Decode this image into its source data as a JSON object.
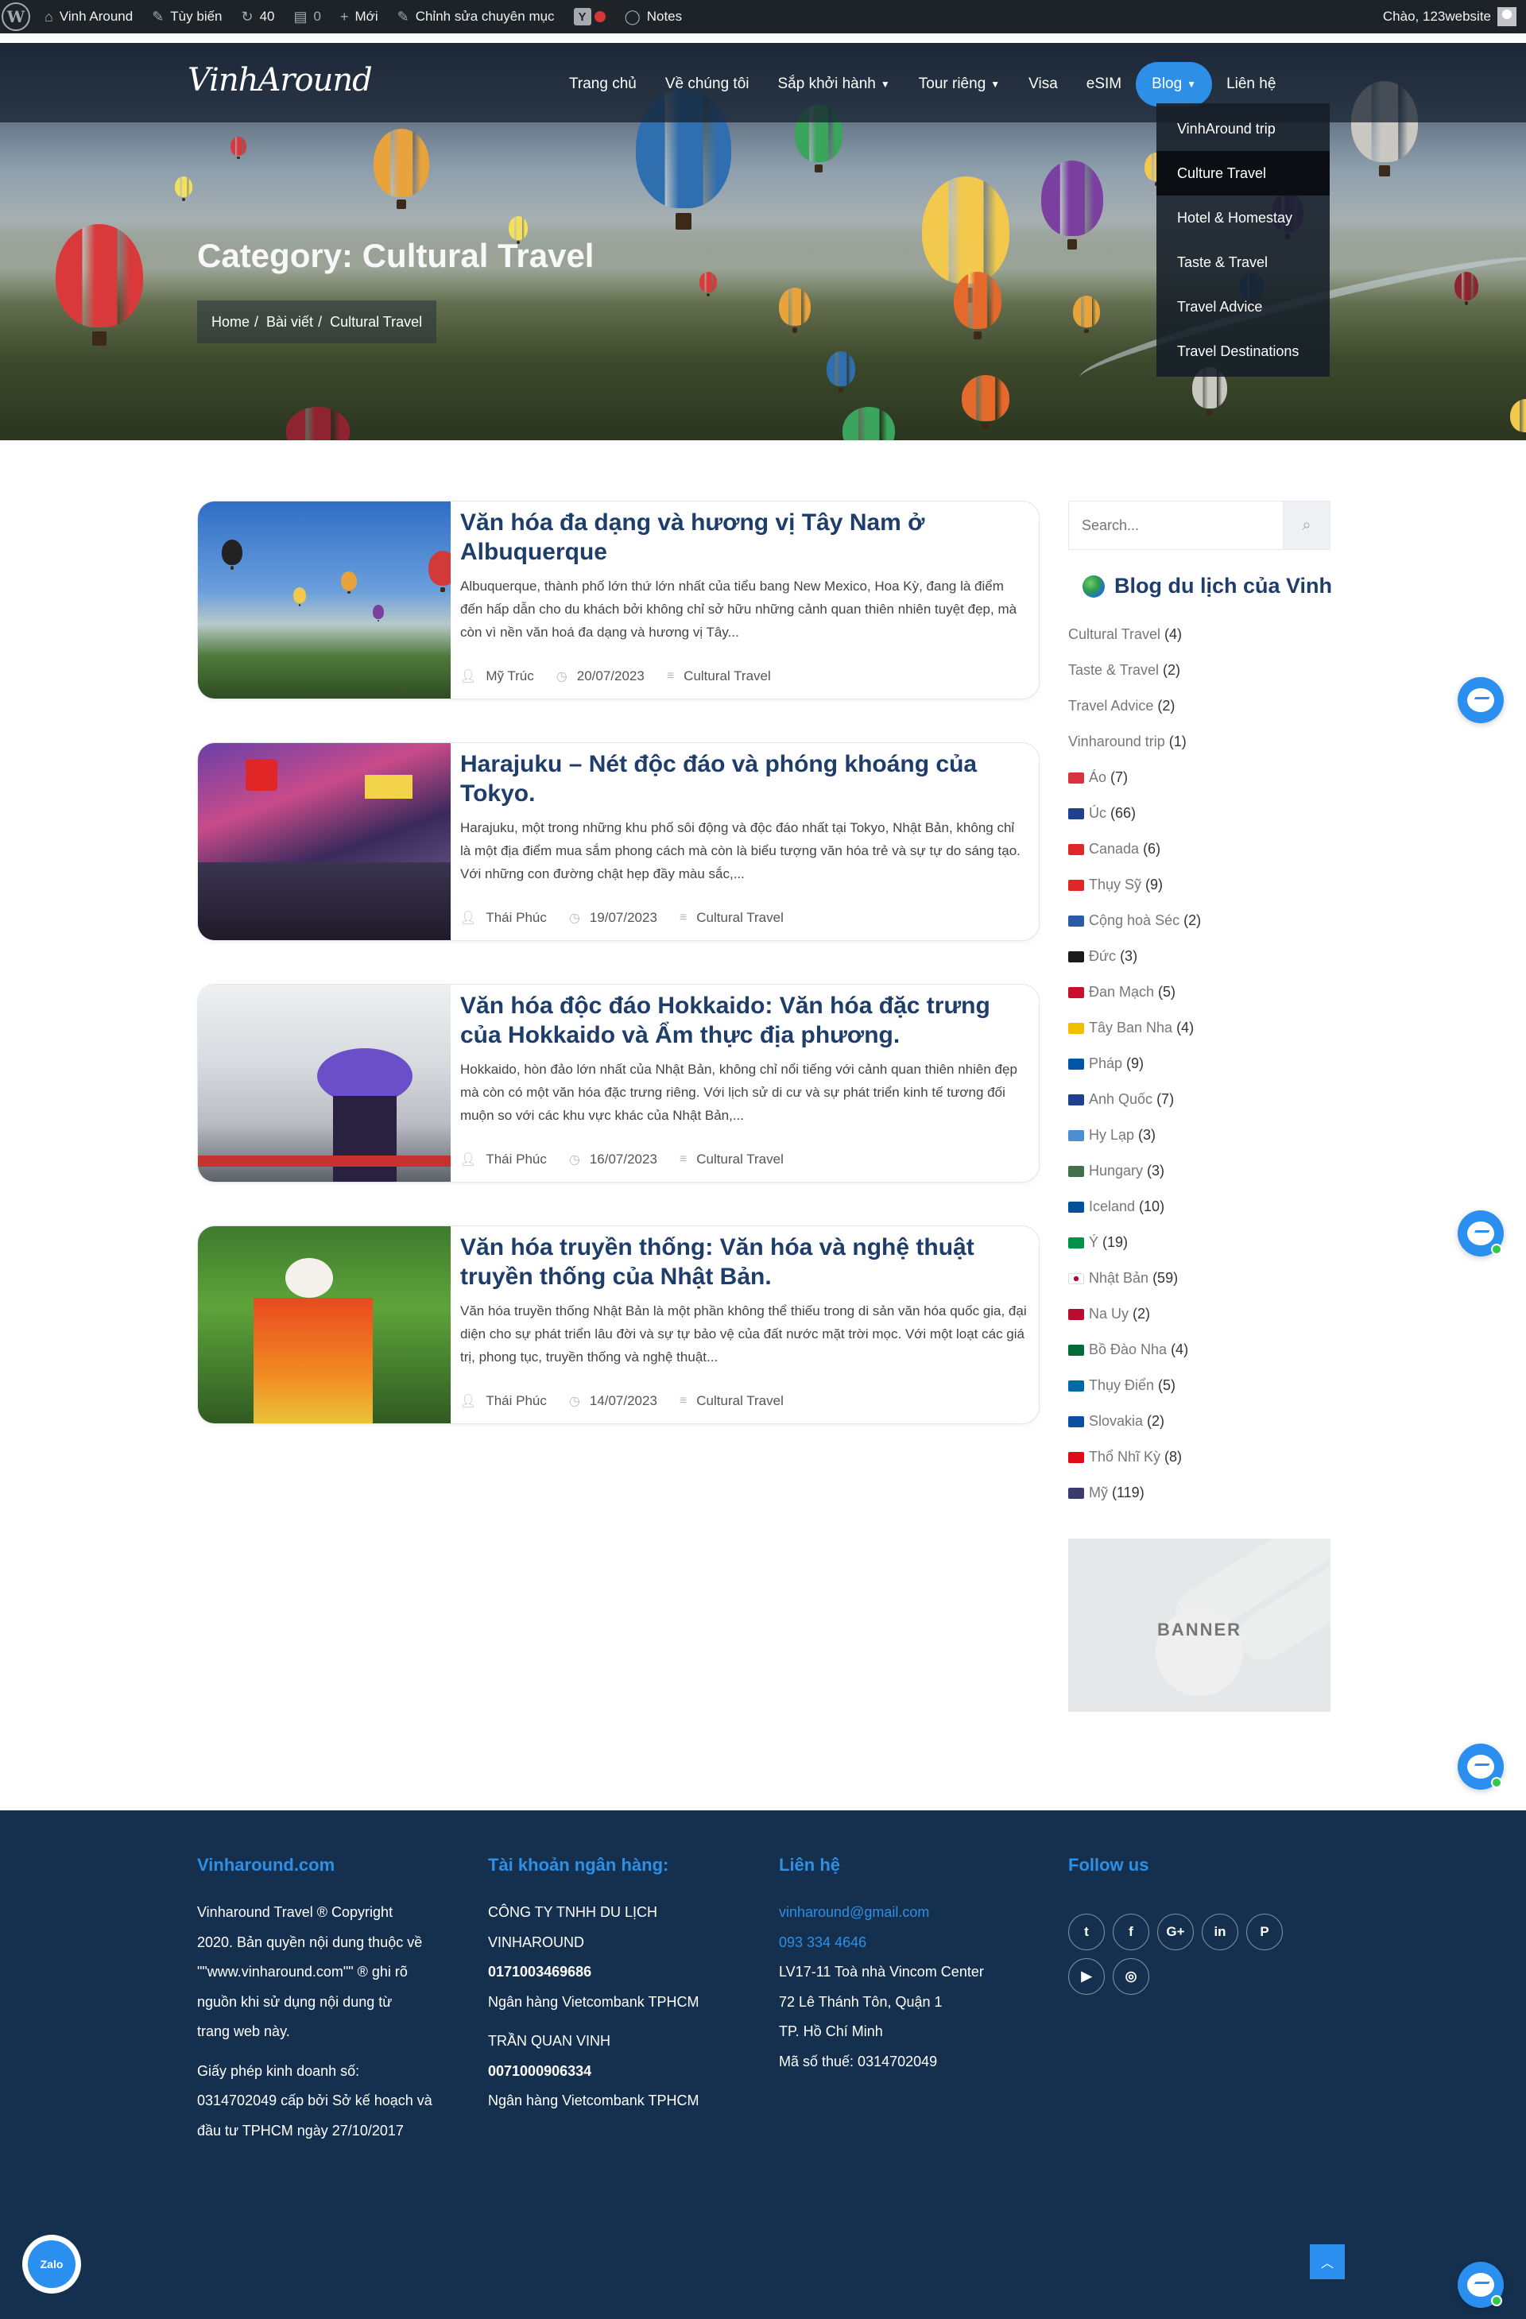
{
  "adminbar": {
    "site_name": "Vinh Around",
    "customize": "Tùy biến",
    "updates": "40",
    "comments": "0",
    "new": "Mới",
    "edit": "Chỉnh sửa chuyên mục",
    "yoast": "Y",
    "notes": "Notes",
    "greeting": "Chào, 123website"
  },
  "header": {
    "logo": "VinhAround",
    "menu": [
      {
        "label": "Trang chủ",
        "caret": false
      },
      {
        "label": "Về chúng tôi",
        "caret": false
      },
      {
        "label": "Sắp khởi hành",
        "caret": true
      },
      {
        "label": "Tour riêng",
        "caret": true
      },
      {
        "label": "Visa",
        "caret": false
      },
      {
        "label": "eSIM",
        "caret": false
      },
      {
        "label": "Blog",
        "caret": true
      },
      {
        "label": "Liên hệ",
        "caret": false
      }
    ],
    "blog_dropdown": [
      "VinhAround trip",
      "Culture Travel",
      "Hotel & Homestay",
      "Taste & Travel",
      "Travel Advice",
      "Travel Destinations"
    ]
  },
  "hero": {
    "title": "Category: Cultural Travel",
    "breadcrumb": [
      "Home",
      "Bài viết",
      "Cultural Travel"
    ],
    "balloon_colors": [
      "#d9393b",
      "#e8a33c",
      "#2f6fb0",
      "#f2c94c",
      "#7b3fa0",
      "#3aa55d",
      "#e5692b",
      "#c8c7c2",
      "#8e2430",
      "#f4e05a"
    ]
  },
  "posts": [
    {
      "title": "Văn hóa đa dạng và hương vị Tây Nam ở Albuquerque",
      "excerpt": "  Albuquerque, thành phố lớn thứ lớn nhất của tiểu bang New Mexico, Hoa Kỳ, đang là điểm đến hấp dẫn cho du khách bởi không chỉ sở hữu những cảnh quan thiên nhiên tuyệt đẹp, mà còn vì nền văn hoá đa dạng và hương vị Tây...",
      "author": "Mỹ Trúc",
      "date": "20/07/2023",
      "category": "Cultural Travel"
    },
    {
      "title": "Harajuku – Nét độc đáo và phóng khoáng của Tokyo.",
      "excerpt": "Harajuku, một trong những khu phố sôi động và độc đáo nhất tại Tokyo, Nhật Bản, không chỉ là một địa điểm mua sắm phong cách mà còn là biểu tượng văn hóa trẻ và sự tự do sáng tạo. Với những con đường chật hẹp đầy màu sắc,...",
      "author": "Thái Phúc",
      "date": "19/07/2023",
      "category": "Cultural Travel"
    },
    {
      "title": "Văn hóa độc đáo Hokkaido: Văn hóa đặc trưng của Hokkaido và Ẩm thực địa phương.",
      "excerpt": "  Hokkaido, hòn đảo lớn nhất của Nhật Bản, không chỉ nổi tiếng với cảnh quan thiên nhiên đẹp mà còn có một văn hóa đặc trưng riêng. Với lịch sử di cư và sự phát triển kinh tế tương đối muộn so với các khu vực khác của Nhật Bản,...",
      "author": "Thái Phúc",
      "date": "16/07/2023",
      "category": "Cultural Travel"
    },
    {
      "title": "Văn hóa truyền thống: Văn hóa và nghệ thuật truyền thống của Nhật Bản.",
      "excerpt": "Văn hóa truyền thống Nhật Bản là một phần không thể thiếu trong di sản văn hóa quốc gia, đại diện cho sự phát triển lâu đời và sự tự bảo vệ của đất nước mặt trời mọc. Với một loạt các giá trị, phong tục, truyền thống và nghệ thuật...",
      "author": "Thái Phúc",
      "date": "14/07/2023",
      "category": "Cultural Travel"
    }
  ],
  "sidebar": {
    "search_placeholder": "Search...",
    "title": "Blog du lịch của Vinh",
    "categories": [
      {
        "name": "Cultural Travel",
        "count": "(4)",
        "flag": null
      },
      {
        "name": "Taste & Travel",
        "count": "(2)",
        "flag": null
      },
      {
        "name": "Travel Advice",
        "count": "(2)",
        "flag": null
      },
      {
        "name": "Vinharound trip",
        "count": "(1)",
        "flag": null
      },
      {
        "name": "Áo",
        "count": "(7)",
        "flag": "#d9333f"
      },
      {
        "name": "Úc",
        "count": "(66)",
        "flag": "#1f3f8f"
      },
      {
        "name": "Canada",
        "count": "(6)",
        "flag": "#e02626"
      },
      {
        "name": "Thụy Sỹ",
        "count": "(9)",
        "flag": "#e02626"
      },
      {
        "name": "Cộng hoà Séc",
        "count": "(2)",
        "flag": "#2b5aa8"
      },
      {
        "name": "Đức",
        "count": "(3)",
        "flag": "#1a1a1a"
      },
      {
        "name": "Đan Mạch",
        "count": "(5)",
        "flag": "#c8102e"
      },
      {
        "name": "Tây Ban Nha",
        "count": "(4)",
        "flag": "#f1bf00"
      },
      {
        "name": "Pháp",
        "count": "(9)",
        "flag": "#0055a4"
      },
      {
        "name": "Anh Quốc",
        "count": "(7)",
        "flag": "#1f3f8f"
      },
      {
        "name": "Hy Lạp",
        "count": "(3)",
        "flag": "#4d8ed0"
      },
      {
        "name": "Hungary",
        "count": "(3)",
        "flag": "#436f4d"
      },
      {
        "name": "Iceland",
        "count": "(10)",
        "flag": "#02529c"
      },
      {
        "name": "Ý",
        "count": "(19)",
        "flag": "#009246"
      },
      {
        "name": "Nhật Bản",
        "count": "(59)",
        "flag": "#ffffff"
      },
      {
        "name": "Na Uy",
        "count": "(2)",
        "flag": "#ba0c2f"
      },
      {
        "name": "Bồ Đào Nha",
        "count": "(4)",
        "flag": "#046a38"
      },
      {
        "name": "Thụy Điển",
        "count": "(5)",
        "flag": "#006aa7"
      },
      {
        "name": "Slovakia",
        "count": "(2)",
        "flag": "#0b4ea2"
      },
      {
        "name": "Thổ Nhĩ Kỳ",
        "count": "(8)",
        "flag": "#e30a17"
      },
      {
        "name": "Mỹ",
        "count": "(119)",
        "flag": "#3c3b6e"
      }
    ],
    "banner": "BANNER"
  },
  "footer": {
    "col1": {
      "title": "Vinharound.com",
      "lines": [
        "Vinharound Travel ® Copyright",
        "2020. Bản quyền nội dung thuộc về",
        "\"\"www.vinharound.com\"\" ® ghi rõ",
        "nguồn khi sử dụng nội dung từ",
        "trang web này.",
        "Giấy phép kinh doanh số:",
        "0314702049 cấp bởi Sở kế hoạch và",
        "đầu tư TPHCM ngày 27/10/2017"
      ]
    },
    "col2": {
      "title": "Tài khoản ngân hàng:",
      "lines": [
        "CÔNG TY TNHH DU LỊCH",
        "VINHAROUND",
        "0171003469686",
        "Ngân hàng Vietcombank TPHCM",
        "TRẦN QUAN VINH",
        "0071000906334",
        "Ngân hàng Vietcombank TPHCM"
      ]
    },
    "col3": {
      "title": "Liên hệ",
      "email": "vinharound@gmail.com",
      "phone": "093 334 4646",
      "lines": [
        "LV17-11 Toà nhà Vincom Center",
        "72 Lê Thánh Tôn, Quận 1",
        "TP. Hồ Chí Minh",
        "Mã số thuế: 0314702049"
      ]
    },
    "col4": {
      "title": "Follow us",
      "social": [
        "twitter-icon",
        "facebook-icon",
        "google-plus-icon",
        "linkedin-icon",
        "pinterest-icon",
        "youtube-icon",
        "instagram-icon"
      ]
    },
    "zalo": "Zalo"
  }
}
